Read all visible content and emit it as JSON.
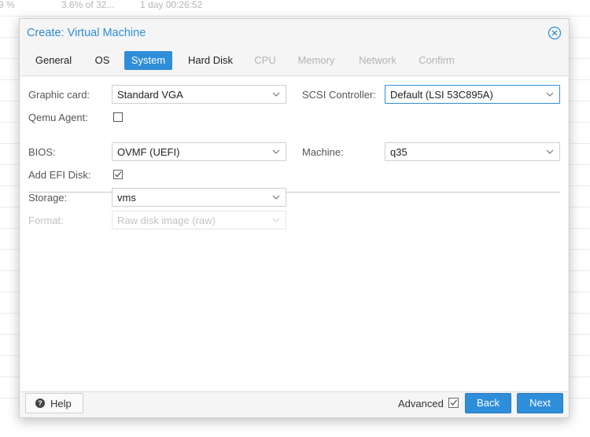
{
  "background": {
    "row_cells": [
      "9 %",
      "3.6% of 32...",
      "1 day 00:26:52"
    ]
  },
  "window": {
    "title": "Create: Virtual Machine",
    "close_icon": "close-circle-icon"
  },
  "tabs": [
    {
      "label": "General",
      "state": "normal"
    },
    {
      "label": "OS",
      "state": "normal"
    },
    {
      "label": "System",
      "state": "active"
    },
    {
      "label": "Hard Disk",
      "state": "normal"
    },
    {
      "label": "CPU",
      "state": "disabled"
    },
    {
      "label": "Memory",
      "state": "disabled"
    },
    {
      "label": "Network",
      "state": "disabled"
    },
    {
      "label": "Confirm",
      "state": "disabled"
    }
  ],
  "form": {
    "graphic_card": {
      "label": "Graphic card:",
      "value": "Standard VGA"
    },
    "scsi_controller": {
      "label": "SCSI Controller:",
      "value": "Default (LSI 53C895A)"
    },
    "qemu_agent": {
      "label": "Qemu Agent:",
      "checked": false
    },
    "bios": {
      "label": "BIOS:",
      "value": "OVMF (UEFI)"
    },
    "machine": {
      "label": "Machine:",
      "value": "q35"
    },
    "add_efi_disk": {
      "label": "Add EFI Disk:",
      "checked": true
    },
    "storage": {
      "label": "Storage:",
      "value": "vms"
    },
    "format": {
      "label": "Format:",
      "value": "Raw disk image (raw)",
      "disabled": true
    }
  },
  "footer": {
    "help_label": "Help",
    "advanced_label": "Advanced",
    "advanced_checked": true,
    "back_label": "Back",
    "next_label": "Next"
  },
  "colors": {
    "accent": "#2f8ed9",
    "disabled_text": "#b4b4b4"
  }
}
